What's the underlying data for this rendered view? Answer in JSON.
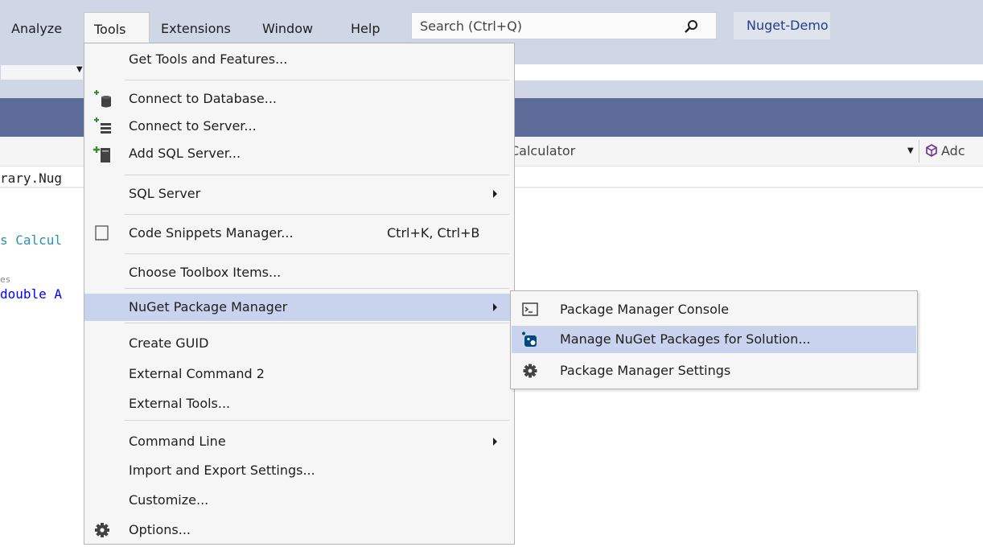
{
  "menubar": {
    "items": [
      "Analyze",
      "Tools",
      "Extensions",
      "Window",
      "Help"
    ],
    "search_placeholder": "Search (Ctrl+Q)",
    "project_name": "Nuget-Demo"
  },
  "navigation_bar": {
    "member_dropdown": "Calculator",
    "add_label": "Adc"
  },
  "code_editor": {
    "lines": [
      "rary.Nug",
      "s Calcul",
      "es",
      "double A"
    ]
  },
  "tools_menu": {
    "items": [
      {
        "label": "Get Tools and Features..."
      },
      {
        "label": "Connect to Database...",
        "icon": "database-plus-icon"
      },
      {
        "label": "Connect to Server...",
        "icon": "server-plus-icon"
      },
      {
        "label": "Add SQL Server...",
        "icon": "sql-server-add-icon"
      },
      {
        "label": "SQL Server",
        "submenu": true
      },
      {
        "label": "Code Snippets Manager...",
        "shortcut": "Ctrl+K, Ctrl+B",
        "icon": "code-snippets-icon"
      },
      {
        "label": "Choose Toolbox Items..."
      },
      {
        "label": "NuGet Package Manager",
        "submenu": true,
        "highlighted": true
      },
      {
        "label": "Create GUID"
      },
      {
        "label": "External Command 2"
      },
      {
        "label": "External Tools..."
      },
      {
        "label": "Command Line",
        "submenu": true
      },
      {
        "label": "Import and Export Settings..."
      },
      {
        "label": "Customize..."
      },
      {
        "label": "Options...",
        "icon": "gear-icon"
      }
    ]
  },
  "nuget_submenu": {
    "items": [
      {
        "label": "Package Manager Console",
        "icon": "console-icon"
      },
      {
        "label": "Manage NuGet Packages for Solution...",
        "icon": "nuget-icon",
        "highlighted": true
      },
      {
        "label": "Package Manager Settings",
        "icon": "gear-icon"
      }
    ]
  },
  "colors": {
    "menubar_bg": "#cfd6e5",
    "tab_well": "#5d6b99",
    "menu_bg": "#f6f6f6",
    "highlight": "#c9d3ee",
    "code_keyword": "#0000ff",
    "code_type": "#2b91af"
  }
}
